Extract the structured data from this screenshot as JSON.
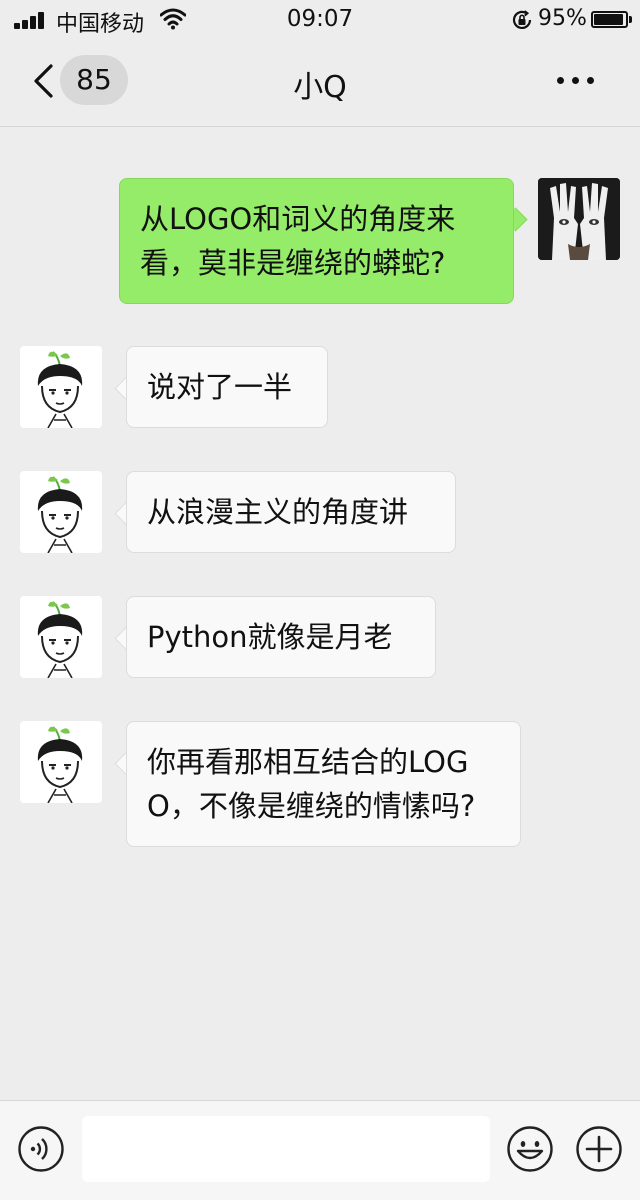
{
  "status_bar": {
    "carrier": "中国移动",
    "time": "09:07",
    "battery_percent": "95%",
    "battery_level": 0.95,
    "icons": [
      "signal-icon",
      "wifi-icon",
      "rotation-lock-icon",
      "battery-icon"
    ]
  },
  "nav": {
    "back_icon": "chevron-left-icon",
    "unread_count": "85",
    "title": "小Q",
    "more_icon": "more-dots-icon"
  },
  "messages": [
    {
      "sender": "self",
      "text": "从LOGO和词义的角度来看，莫非是缠绕的蟒蛇?"
    },
    {
      "sender": "bot",
      "text": "说对了一半"
    },
    {
      "sender": "bot",
      "text": "从浪漫主义的角度讲"
    },
    {
      "sender": "bot",
      "text": "Python就像是月老"
    },
    {
      "sender": "bot",
      "text": "你再看那相互结合的LOGO，不像是缠绕的情愫吗?"
    }
  ],
  "input_bar": {
    "voice_icon": "voice-icon",
    "input_value": "",
    "emoji_icon": "emoji-icon",
    "plus_icon": "plus-icon"
  },
  "colors": {
    "background": "#ededed",
    "self_bubble": "#95ec69",
    "bot_bubble": "#f9f9f9"
  }
}
